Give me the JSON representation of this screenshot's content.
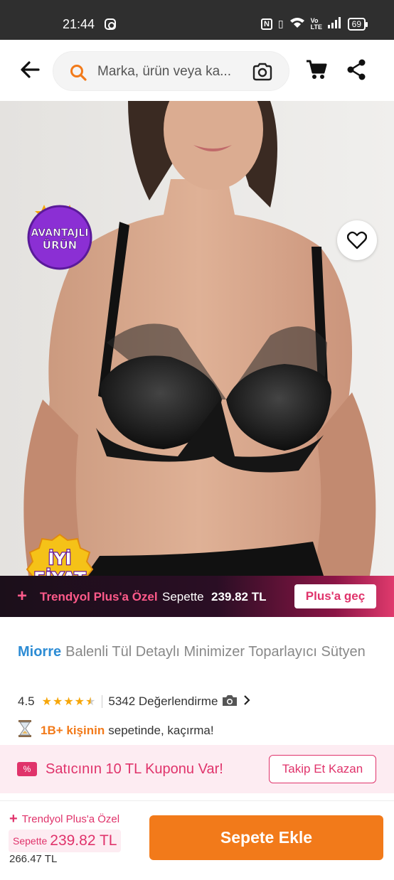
{
  "status_bar": {
    "time": "21:44",
    "network_label": "Vo LTE",
    "battery": "69"
  },
  "header": {
    "search_placeholder": "Marka, ürün veya ka...",
    "icons": [
      "back-arrow-icon",
      "search-icon",
      "camera-icon",
      "cart-icon",
      "share-icon"
    ]
  },
  "gallery": {
    "badge_top": [
      "AVANTAJLI",
      "ÜRÜN"
    ],
    "badge_bottom": [
      "İYİ",
      "FİYAT"
    ],
    "variant_count": "8",
    "page_count": 5,
    "active_page": 2
  },
  "plus_banner": {
    "label": "Trendyol Plus'a Özel",
    "basket_label": "Sepette",
    "price": "239.82 TL",
    "button": "Plus'a geç"
  },
  "product": {
    "brand": "Miorre",
    "name": "Balenli Tül Detaylı Minimizer Toparlayıcı Sütyen",
    "rating": "4.5",
    "stars": 4.5,
    "reviews": "5342 Değerlendirme",
    "social_highlight": "1B+ kişinin",
    "social_rest": "sepetinde, kaçırma!"
  },
  "coupon": {
    "icon_text": "%",
    "text": "Satıcının 10 TL Kuponu Var!",
    "button": "Takip Et Kazan"
  },
  "bottom_bar": {
    "plus_label": "Trendyol Plus'a Özel",
    "basket_label": "Sepette",
    "price": "239.82 TL",
    "old_price": "266.47 TL",
    "add_button": "Sepete Ekle"
  },
  "colors": {
    "accent_orange": "#f27a1a",
    "plus_pink": "#e0336b",
    "brand_blue": "#2d8cd4",
    "star_gold": "#f6a609"
  }
}
